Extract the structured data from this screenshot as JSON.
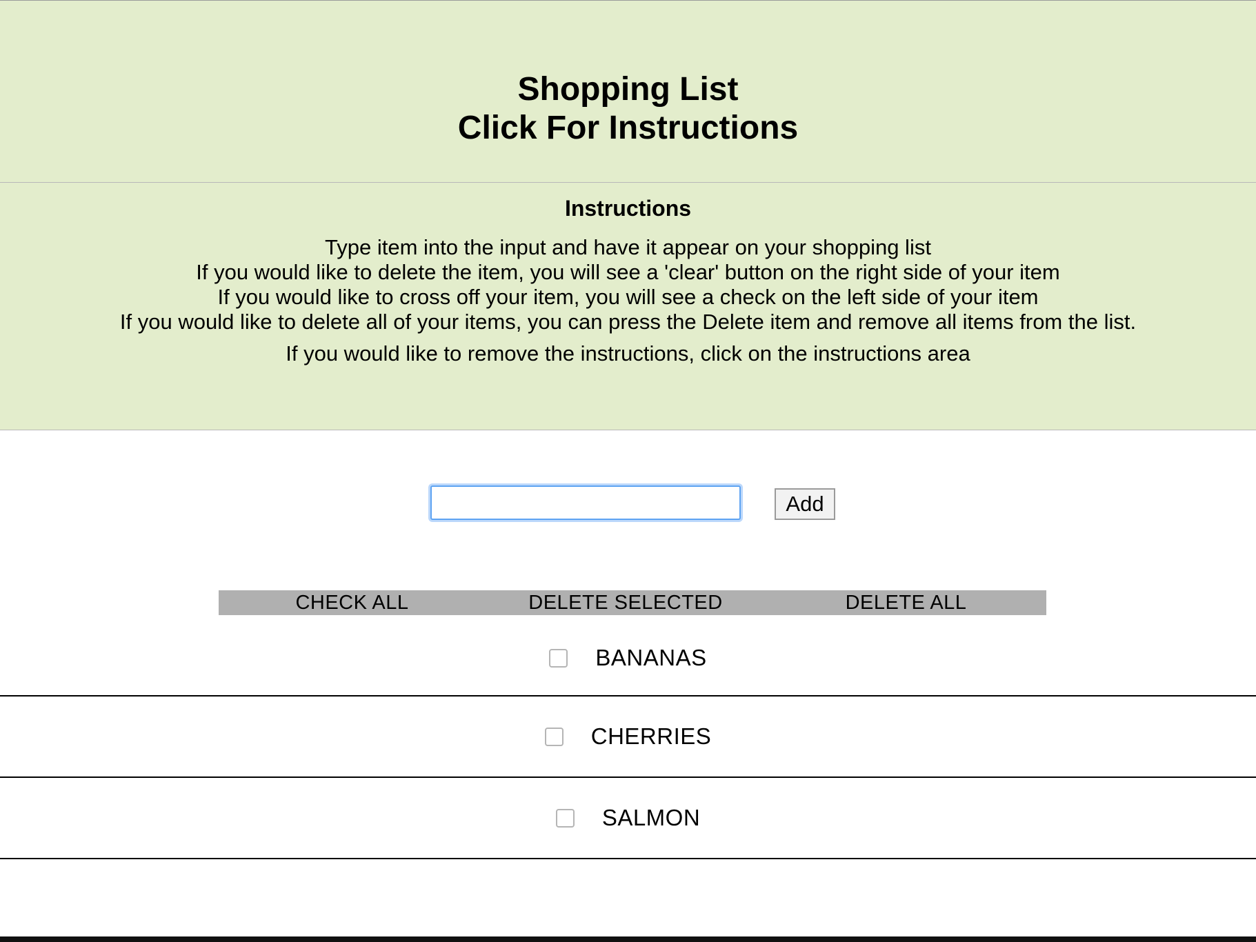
{
  "header": {
    "title": "Shopping List",
    "instructions_toggle": "Click For Instructions"
  },
  "instructions": {
    "heading": "Instructions",
    "lines": [
      "Type item into the input and have it appear on your shopping list",
      "If you would like to delete the item, you will see a 'clear' button on the right side of your item",
      "If you would like to cross off your item, you will see a check on the left side of your item",
      "If you would like to delete all of your items, you can press the Delete item and remove all items from the list.",
      "If you would like to remove the instructions, click on the instructions area"
    ]
  },
  "form": {
    "input_value": "",
    "add_label": "Add"
  },
  "actions": {
    "check_all": "CHECK ALL",
    "delete_selected": "DELETE SELECTED",
    "delete_all": "DELETE ALL"
  },
  "items": [
    {
      "label": "BANANAS",
      "checked": false
    },
    {
      "label": "CHERRIES",
      "checked": false
    },
    {
      "label": "SALMON",
      "checked": false
    }
  ],
  "colors": {
    "panel_background": "#e3edcc",
    "actions_bar": "#b0b0b0",
    "input_focus": "#5ea3f2"
  },
  "icons": {
    "item_checkbox": "checkbox-icon"
  }
}
